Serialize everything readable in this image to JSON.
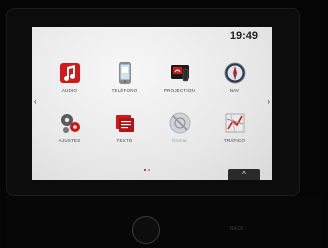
{
  "status": {
    "time": "19:49"
  },
  "apps": [
    {
      "label": "AUDIO",
      "icon": "music-note-icon"
    },
    {
      "label": "TELÉFONO",
      "icon": "phone-icon"
    },
    {
      "label": "PROJECTION",
      "icon": "projection-icon"
    },
    {
      "label": "NAV",
      "icon": "compass-icon"
    },
    {
      "label": "AJUSTES",
      "icon": "gears-icon"
    },
    {
      "label": "TEXTO",
      "icon": "text-message-icon"
    },
    {
      "label": "OnStar",
      "icon": "onstar-disabled-icon"
    },
    {
      "label": "TRÁFICO",
      "icon": "traffic-map-icon"
    }
  ],
  "nav": {
    "prev": "‹",
    "next": "›"
  },
  "bottom": {
    "expand_label": "^"
  },
  "console_labels": {
    "back": "BACK"
  },
  "colors": {
    "accent": "#d01919",
    "screen_bg": "#e9e9e9"
  }
}
